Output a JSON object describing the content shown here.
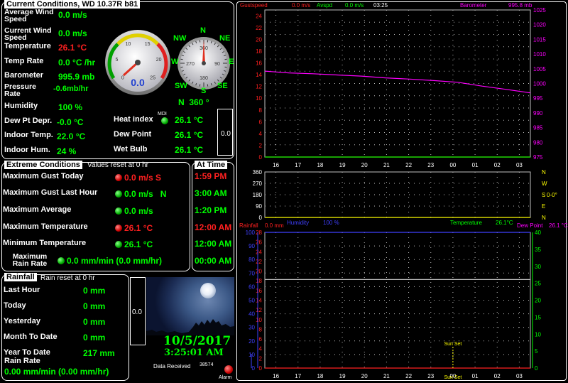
{
  "current": {
    "title": "Current Conditions, WD 10.37R b81",
    "rows": [
      {
        "label": "Average Wind Speed",
        "value": "0.0 m/s"
      },
      {
        "label": "Current Wind Speed",
        "value": "0.0 m/s"
      },
      {
        "label": "Temperature",
        "value": "26.1 °C"
      },
      {
        "label": "Temp Rate",
        "value": "0.0 °C /hr"
      },
      {
        "label": "Barometer",
        "value": "995.9 mb"
      },
      {
        "label": "Pressure Rate",
        "value": "-0.6mb/hr"
      },
      {
        "label": "Humidity",
        "value": "100 %"
      },
      {
        "label": "Dew Pt Depr.",
        "value": "-0.0 °C"
      },
      {
        "label": "Indoor Temp.",
        "value": "22.0 °C"
      },
      {
        "label": "Indoor Hum.",
        "value": "24 %"
      }
    ],
    "heat_index": {
      "label": "Heat index",
      "value": "26.1 °C",
      "badge": "MDI"
    },
    "dew_point": {
      "label": "Dew Point",
      "value": "26.1 °C"
    },
    "wet_bulb": {
      "label": "Wet Bulb",
      "value": "26.1 °C"
    },
    "wind_dir": "N  360 °",
    "small_box": "0.0",
    "gauge_value": "0.0",
    "gauge_ticks": [
      "0",
      "5",
      "10",
      "15",
      "20",
      "25"
    ],
    "compass": {
      "N": "N",
      "NE": "NE",
      "E": "E",
      "SE": "SE",
      "S": "S",
      "SW": "SW",
      "W": "W",
      "NW": "NW",
      "ticks": [
        "360",
        "90",
        "180",
        "270"
      ]
    }
  },
  "extreme": {
    "title": "Extreme Conditions",
    "subtitle": "Values reset at 0 hr",
    "rows": [
      {
        "label": "Maximum Gust Today",
        "value": "0.0 m/s S",
        "color": "red"
      },
      {
        "label": "Maximum Gust Last Hour",
        "value": "0.0 m/s   N",
        "color": "green"
      },
      {
        "label": "Maximum Average",
        "value": "0.0 m/s",
        "color": "green"
      },
      {
        "label": "Maximum Temperature",
        "value": "26.1 °C",
        "color": "red"
      },
      {
        "label": "Minimum Temperature",
        "value": "26.1 °C",
        "color": "green"
      },
      {
        "label": "Maximum Rain Rate",
        "value": "0.0 mm/min (0.0 mm/hr)",
        "color": "green"
      }
    ]
  },
  "attime": {
    "title": "At Time",
    "times": [
      {
        "t": "1:59 PM",
        "color": "red"
      },
      {
        "t": "3:00 AM",
        "color": "green"
      },
      {
        "t": "1:20 PM",
        "color": "green"
      },
      {
        "t": "12:00 AM",
        "color": "red"
      },
      {
        "t": "12:00 AM",
        "color": "green"
      },
      {
        "t": "00:00 AM",
        "color": "green"
      }
    ]
  },
  "rainfall": {
    "title": "Rainfall",
    "subtitle": "Rain reset at 0 hr",
    "rows": [
      {
        "label": "Last Hour",
        "value": "0 mm"
      },
      {
        "label": "Today",
        "value": "0 mm"
      },
      {
        "label": "Yesterday",
        "value": "0 mm"
      },
      {
        "label": "Month To Date",
        "value": "0 mm"
      },
      {
        "label": "Year To Date",
        "value": "217 mm"
      }
    ],
    "rate_label": "Rain Rate",
    "rate_value": "0.00 mm/min (0.00 mm/hr)"
  },
  "camera": {
    "side_value": "0.0",
    "date": "10/5/2017",
    "time": "3:25:01 AM",
    "data_received_label": "Data Received",
    "data_received_value": "38574",
    "alarm_label": "Alarm"
  },
  "graph1": {
    "legend": [
      {
        "text": "Gustspeed",
        "color": "#ff2020"
      },
      {
        "text": "0.0 m/s",
        "color": "#ff2020"
      },
      {
        "text": "Avspd",
        "color": "#00ff00"
      },
      {
        "text": "0.0 m/s",
        "color": "#00ff00"
      },
      {
        "text": "03:25",
        "color": "#ffffff"
      },
      {
        "text": "Barometer",
        "color": "#ff00ff"
      },
      {
        "text": "995.8 mb",
        "color": "#ff00ff"
      }
    ]
  },
  "graph2": {
    "legend": [
      {
        "text": "Humidity",
        "color": "#4040ff"
      },
      {
        "text": "100 %",
        "color": "#4040ff"
      },
      {
        "text": "Temperature",
        "color": "#00ff00"
      },
      {
        "text": "26.1°C",
        "color": "#00ff00"
      },
      {
        "text": "Dew Point",
        "color": "#ff00ff"
      },
      {
        "text": "26.1 °C",
        "color": "#ff00ff"
      },
      {
        "text": "Rainfall",
        "color": "#ff2020"
      },
      {
        "text": "0.0 mm",
        "color": "#ff2020"
      }
    ],
    "sunset_label": "Sun Set",
    "sunset_label2": "Sun Set"
  },
  "chart_data": [
    {
      "type": "line",
      "x": [
        "16",
        "17",
        "18",
        "19",
        "20",
        "21",
        "22",
        "23",
        "00",
        "01",
        "02",
        "03"
      ],
      "left_axis": {
        "ticks": [
          "0",
          "2",
          "4",
          "6",
          "8",
          "10",
          "12",
          "14",
          "16",
          "18",
          "20",
          "22",
          "24"
        ],
        "ylim": [
          0,
          25
        ]
      },
      "right_axis": {
        "ticks": [
          "975",
          "980",
          "985",
          "990",
          "995",
          "1000",
          "1005",
          "1010",
          "1015",
          "1020",
          "1025"
        ],
        "ylim": [
          975,
          1025
        ]
      },
      "series": [
        {
          "name": "Gustspeed",
          "axis": "left",
          "color": "#ff2020",
          "values": [
            0,
            0,
            0,
            0,
            0,
            0,
            0,
            0,
            0,
            0,
            0,
            0
          ]
        },
        {
          "name": "Avspd",
          "axis": "left",
          "color": "#00ff00",
          "values": [
            0,
            0,
            0,
            0,
            0,
            0,
            0,
            0,
            0,
            0,
            0,
            0
          ]
        },
        {
          "name": "Barometer",
          "axis": "right",
          "color": "#ff00ff",
          "values": [
            1004.2,
            1003.6,
            1003.3,
            1002.9,
            1002.5,
            1001.9,
            1001.5,
            1001.0,
            1000.4,
            999.1,
            998.0,
            996.8
          ]
        }
      ]
    },
    {
      "type": "line",
      "x": [
        "16",
        "17",
        "18",
        "19",
        "20",
        "21",
        "22",
        "23",
        "00",
        "01",
        "02",
        "03"
      ],
      "left_axis": {
        "ticks": [
          "0",
          "90",
          "180",
          "270",
          "360"
        ],
        "ylim": [
          0,
          360
        ]
      },
      "right_axis": {
        "ticks": [
          "N",
          "W",
          "S",
          "E",
          "N"
        ],
        "extra": "0-0°"
      },
      "series": [
        {
          "name": "Wind direction",
          "color": "#ffff00",
          "values": [
            0,
            0,
            0,
            0,
            0,
            0,
            0,
            0,
            0,
            0,
            0,
            0
          ]
        }
      ]
    },
    {
      "type": "line",
      "x": [
        "16",
        "17",
        "18",
        "19",
        "20",
        "21",
        "22",
        "23",
        "00",
        "01",
        "02",
        "03"
      ],
      "left_axis": {
        "ticks": [
          "0",
          "10",
          "20",
          "30",
          "40",
          "50",
          "60",
          "70",
          "80",
          "90",
          "100"
        ],
        "ylim": [
          0,
          100
        ]
      },
      "mid_axis": {
        "ticks": [
          "0",
          "2",
          "4",
          "6",
          "8",
          "10",
          "12",
          "14",
          "16",
          "18",
          "20",
          "22",
          "24",
          "26",
          "28"
        ]
      },
      "right_axis": {
        "ticks": [
          "0",
          "5",
          "10",
          "15",
          "20",
          "25",
          "30",
          "35",
          "40"
        ],
        "ylim": [
          0,
          40
        ]
      },
      "series": [
        {
          "name": "Humidity",
          "axis": "left",
          "color": "#4040ff",
          "values": [
            100,
            100,
            100,
            100,
            100,
            100,
            100,
            100,
            100,
            100,
            100,
            100
          ]
        },
        {
          "name": "Temperature",
          "axis": "right",
          "color": "#c0c0c0",
          "values": [
            26.1,
            26.1,
            26.1,
            26.1,
            26.1,
            26.1,
            26.1,
            26.1,
            26.1,
            26.1,
            26.1,
            26.1
          ]
        },
        {
          "name": "Rainfall",
          "axis": "left",
          "color": "#ff2020",
          "values": [
            0,
            0,
            0,
            0,
            0,
            0,
            0,
            0,
            0,
            0,
            0,
            0
          ]
        }
      ]
    }
  ]
}
